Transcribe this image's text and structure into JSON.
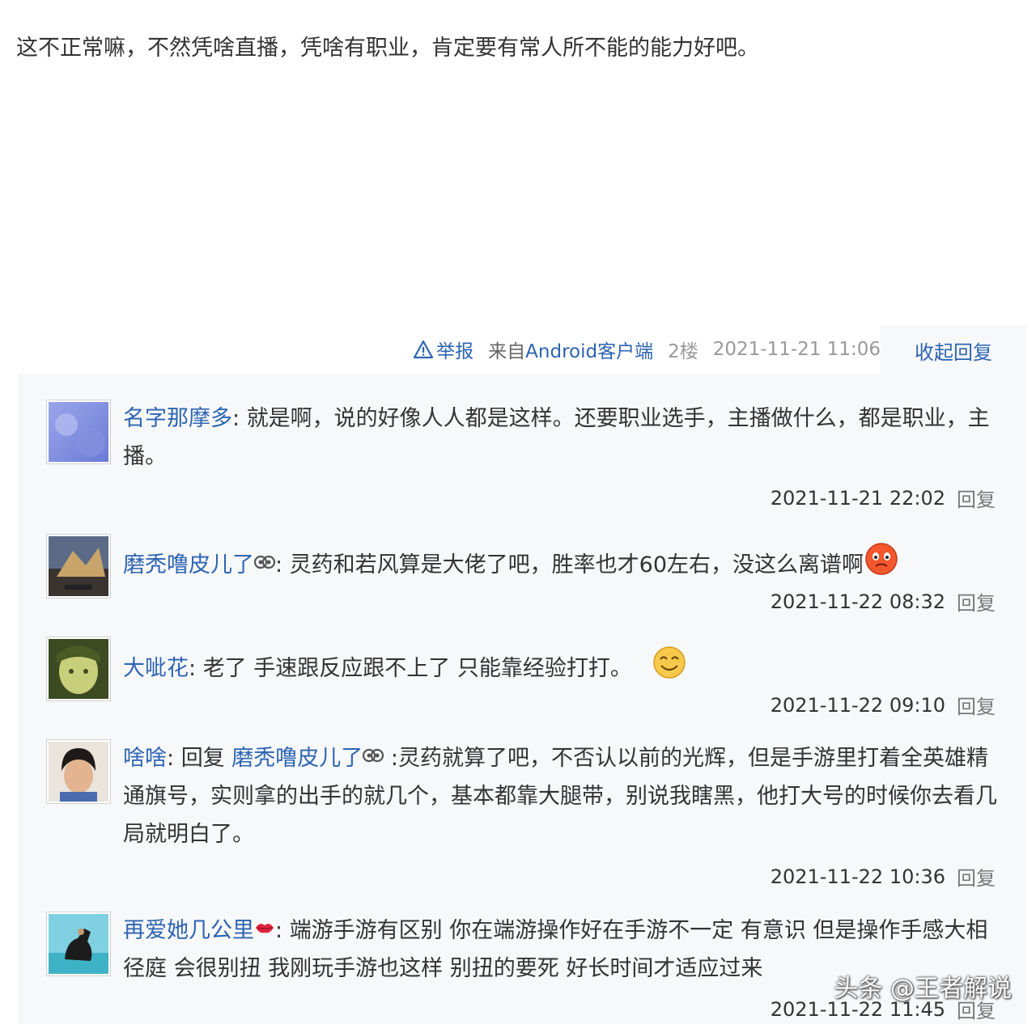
{
  "post": {
    "content": "这不正常嘛，不然凭啥直播，凭啥有职业，肯定要有常人所不能的能力好吧。",
    "report_label": "举报",
    "client_prefix": "来自",
    "client_name": "Android客户端",
    "floor": "2楼",
    "time": "2021-11-21 11:06",
    "collapse_label": "收起回复"
  },
  "replies": [
    {
      "user": "名字那摩多",
      "text": "就是啊，说的好像人人都是这样。还要职业选手，主播做什么，都是职业，主播。",
      "time": "2021-11-21 22:02",
      "reply_label": "回复",
      "avatar_icon": "avatar-purple-abstract"
    },
    {
      "user": "磨秃噜皮儿了",
      "user_tag_icon": "member-badge-icon",
      "text": "灵药和若风算是大佬了吧，胜率也才60左右，没这么离谱啊",
      "emoji": "angry-face-emoji",
      "time": "2021-11-22 08:32",
      "reply_label": "回复",
      "avatar_icon": "avatar-game-poster"
    },
    {
      "user": "大呲花",
      "text": "老了 手速跟反应跟不上了 只能靠经验打打。",
      "emoji": "smile-face-emoji",
      "time": "2021-11-22 09:10",
      "reply_label": "回复",
      "avatar_icon": "avatar-green-face"
    },
    {
      "user": "啥啥",
      "reply_prefix": "回复",
      "reply_to": "磨秃噜皮儿了",
      "reply_to_tag_icon": "member-badge-icon",
      "text": ":灵药就算了吧，不否认以前的光辉，但是手游里打着全英雄精通旗号，实则拿的出手的就几个，基本都靠大腿带，别说我瞎黑，他打大号的时候你去看几局就明白了。",
      "time": "2021-11-22 10:36",
      "reply_label": "回复",
      "avatar_icon": "avatar-child-photo"
    },
    {
      "user": "再爱她几公里",
      "user_tag_icon": "lips-badge-icon",
      "text": "端游手游有区别 你在端游操作好在手游不一定 有意识 但是操作手感大相径庭 会很别扭 我刚玩手游也这样 别扭的要死 好长时间才适应过来",
      "time": "2021-11-22 11:45",
      "reply_label": "回复",
      "avatar_icon": "avatar-horse-sea"
    }
  ],
  "watermark": "头条 @王者解说",
  "colors": {
    "link": "#2d64b3",
    "reply_bg": "#f7f8fa",
    "text": "#333333"
  }
}
